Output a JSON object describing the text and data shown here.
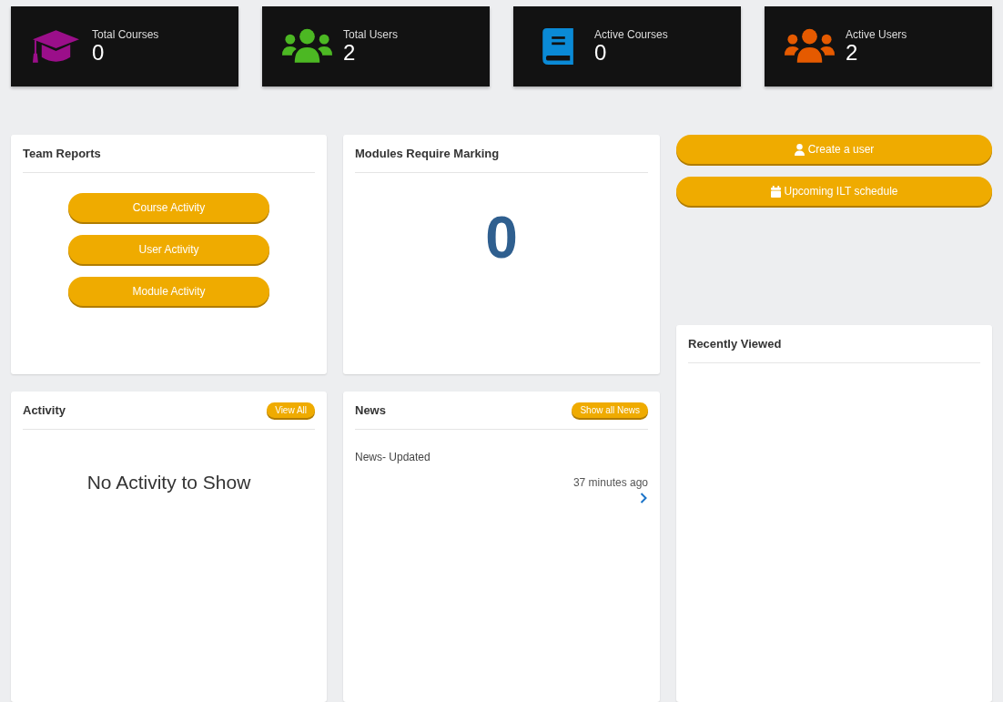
{
  "stats": [
    {
      "kind": "cap",
      "label": "Total Courses",
      "value": "0",
      "color": "#9b0f8a"
    },
    {
      "kind": "users",
      "label": "Total Users",
      "value": "2",
      "color": "#4cb823"
    },
    {
      "kind": "book",
      "label": "Active Courses",
      "value": "0",
      "color": "#0a8ad6"
    },
    {
      "kind": "users",
      "label": "Active Users",
      "value": "2",
      "color": "#e55a00"
    }
  ],
  "team_reports": {
    "title": "Team Reports",
    "buttons": [
      "Course Activity",
      "User Activity",
      "Module Activity"
    ]
  },
  "modules_require_marking": {
    "title": "Modules Require Marking",
    "count": "0"
  },
  "actions": [
    {
      "kind": "user",
      "label": "Create a user"
    },
    {
      "kind": "calendar",
      "label": "Upcoming ILT schedule"
    }
  ],
  "recently_viewed": {
    "title": "Recently Viewed"
  },
  "activity": {
    "title": "Activity",
    "button": "View All",
    "empty": "No Activity to Show"
  },
  "news": {
    "title": "News",
    "button": "Show all News",
    "items": [
      {
        "title": "News- Updated",
        "time": "37 minutes ago"
      }
    ]
  }
}
